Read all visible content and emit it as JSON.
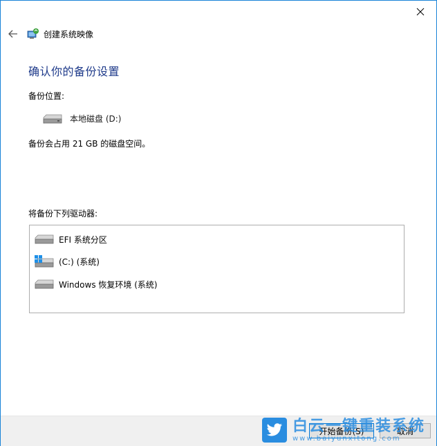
{
  "window": {
    "title": "创建系统映像"
  },
  "page": {
    "heading": "确认你的备份设置",
    "backup_location_label": "备份位置:",
    "backup_location_value": "本地磁盘 (D:)",
    "space_note": "备份会占用 21 GB 的磁盘空间。",
    "drives_label": "将备份下列驱动器:"
  },
  "drives": [
    {
      "label": "EFI 系统分区",
      "icon": "drive-icon"
    },
    {
      "label": "(C:) (系统)",
      "icon": "windows-drive-icon"
    },
    {
      "label": "Windows 恢复环境 (系统)",
      "icon": "drive-icon"
    }
  ],
  "footer": {
    "start_button": "开始备份(S)",
    "cancel_button": "取消"
  },
  "watermark": {
    "main": "白云一键重装系统",
    "sub": "www.baiyunxitong.com"
  },
  "colors": {
    "accent": "#1883d7",
    "heading": "#1e3a8a",
    "footer_bg": "#f0f0f0"
  }
}
